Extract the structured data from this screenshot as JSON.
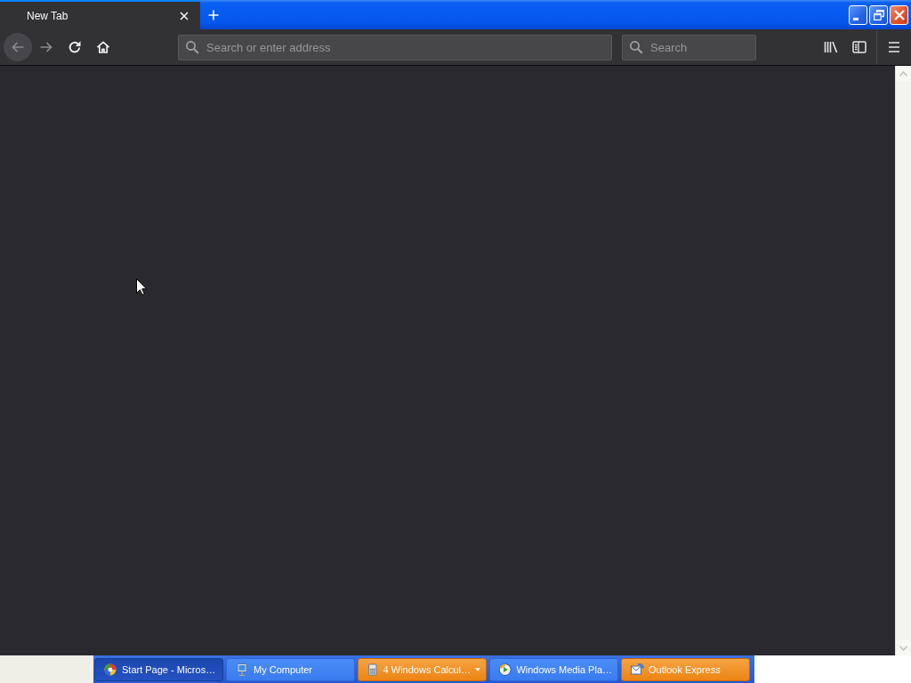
{
  "tabs": [
    {
      "title": "New Tab",
      "selected": true
    }
  ],
  "navigation": [
    {
      "kind": "back",
      "disabled": true,
      "hovered": true
    },
    {
      "kind": "forward",
      "disabled": true,
      "hovered": false
    },
    {
      "kind": "reload",
      "disabled": false,
      "hovered": false
    },
    {
      "kind": "home",
      "disabled": false,
      "hovered": false
    }
  ],
  "address_bar": {
    "placeholder": "Search or enter address"
  },
  "search_bar": {
    "placeholder": "Search"
  },
  "taskbar": {
    "items": [
      {
        "kind": "window",
        "label": "Start Page - Micros…",
        "selected": true,
        "flashing": false
      },
      {
        "kind": "window",
        "label": "My Computer",
        "selected": false,
        "flashing": false
      },
      {
        "kind": "group",
        "count": "4",
        "label": "Windows Calcul…",
        "selected": false,
        "flashing": true
      },
      {
        "kind": "window",
        "label": "Windows Media Pla…",
        "selected": false,
        "flashing": false
      },
      {
        "kind": "window",
        "label": "Outlook Express",
        "selected": false,
        "flashing": true
      }
    ]
  }
}
